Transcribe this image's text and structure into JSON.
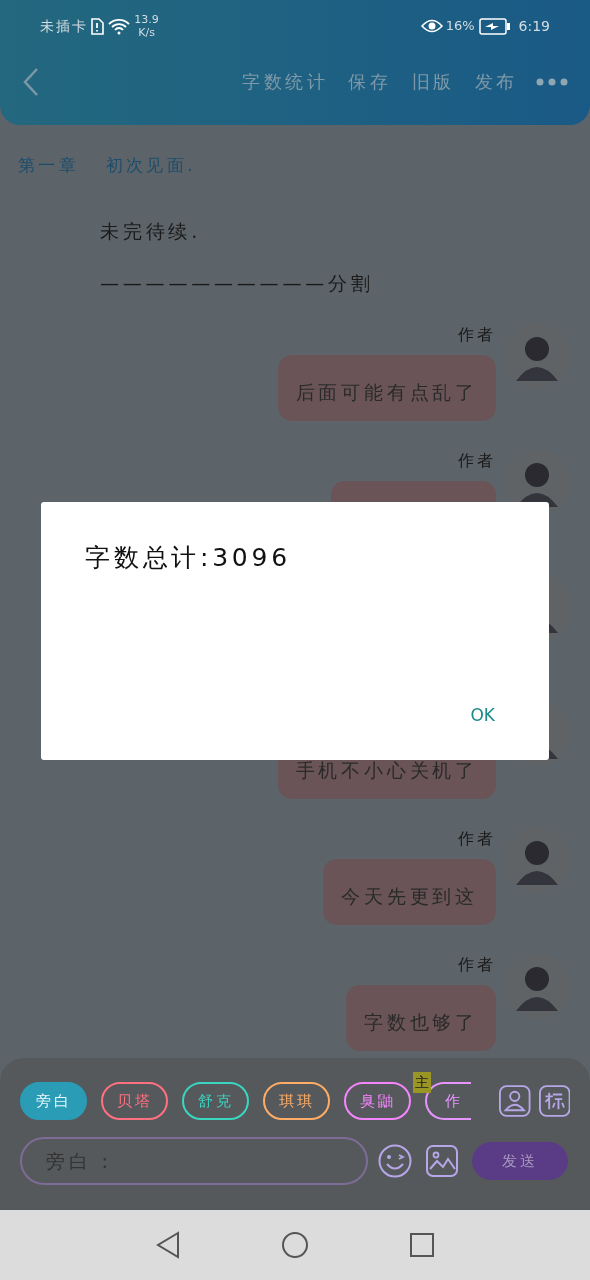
{
  "status_bar": {
    "carrier": "未插卡",
    "speed": "13.9",
    "speed_unit": "K/s",
    "battery": "16%",
    "time": "6:19"
  },
  "toolbar": {
    "actions": [
      "字数统计",
      "保存",
      "旧版",
      "发布"
    ]
  },
  "chapter_title": "第一章   初次见面.",
  "paragraphs": [
    "未完待续.",
    "——————————分割"
  ],
  "messages": [
    {
      "author": "作者",
      "text": "后面可能有点乱了",
      "avatar": true
    },
    {
      "author": "作者",
      "avatar": true
    },
    {
      "avatar": true
    },
    {
      "text": "手机不小心关机了",
      "avatar": true
    },
    {
      "author": "作者",
      "text": "今天先更到这",
      "avatar": true
    },
    {
      "author": "作者",
      "text": "字数也够了",
      "avatar": true
    }
  ],
  "roles": [
    {
      "name": "旁白",
      "color": "#2a9cb6",
      "selected": true
    },
    {
      "name": "贝塔",
      "color": "#ff7080",
      "selected": false
    },
    {
      "name": "舒克",
      "color": "#3ad6c0",
      "selected": false
    },
    {
      "name": "琪琪",
      "color": "#ffac66",
      "selected": false
    },
    {
      "name": "臭鼬",
      "color": "#f585ff",
      "selected": false
    },
    {
      "name": "作",
      "color": "#e695ff",
      "selected": false,
      "badge": "主"
    }
  ],
  "input": {
    "placeholder": "旁白 :"
  },
  "send": "发送",
  "dialog": {
    "message": "字数总计:3096",
    "button": "OK"
  }
}
